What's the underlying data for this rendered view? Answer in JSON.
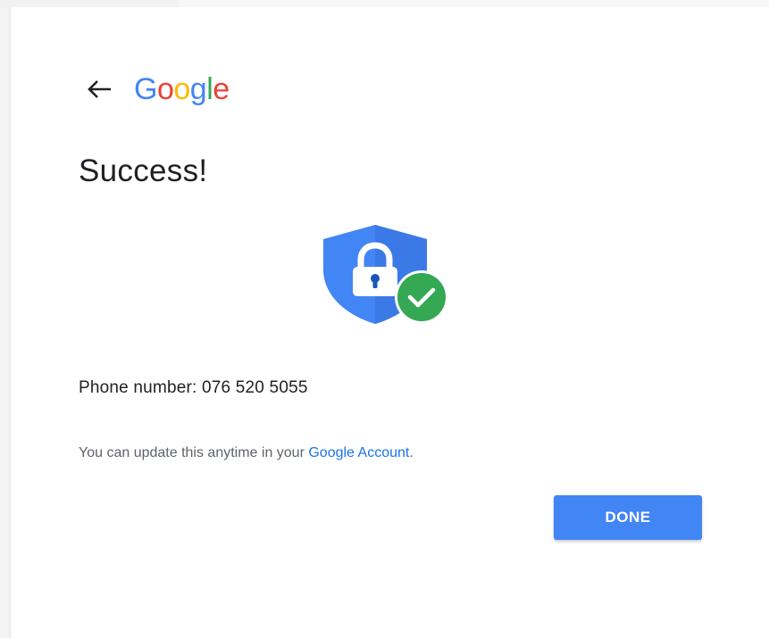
{
  "header": {
    "back_icon": "arrow-left-icon",
    "logo_letters": [
      {
        "char": "G",
        "color": "#4285f4"
      },
      {
        "char": "o",
        "color": "#ea4335"
      },
      {
        "char": "o",
        "color": "#fbbc05"
      },
      {
        "char": "g",
        "color": "#4285f4"
      },
      {
        "char": "l",
        "color": "#34a853"
      },
      {
        "char": "e",
        "color": "#ea4335"
      }
    ]
  },
  "main": {
    "title": "Success!",
    "illustration_icon": "shield-lock-check-icon",
    "phone_text": "Phone number: 076 520 5055",
    "note_prefix": "You can update this anytime in your ",
    "note_link": "Google Account",
    "note_suffix": ".",
    "done_label": "DONE"
  },
  "colors": {
    "accent": "#4285f4",
    "link": "#1a73e8",
    "success_green": "#34a853",
    "shield_blue": "#4285f4",
    "shield_dark": "#1a73e8"
  }
}
